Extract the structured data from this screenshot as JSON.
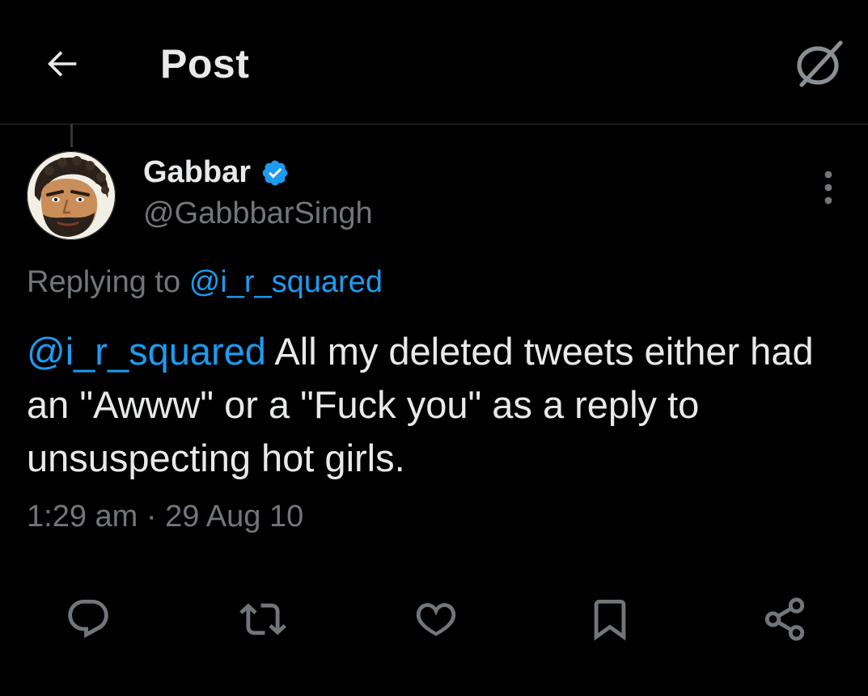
{
  "header": {
    "title": "Post",
    "back_icon": "arrow-left-icon",
    "grok_icon": "grok-icon"
  },
  "post": {
    "author": {
      "display_name": "Gabbar",
      "handle": "@GabbbarSingh",
      "verified": true,
      "verified_color": "#1d9bf0"
    },
    "replying_prefix": "Replying to",
    "replying_to": "@i_r_squared",
    "mention": "@i_r_squared",
    "text": " All my deleted tweets either had an \"Awww\" or a \"Fuck you\" as a reply to unsuspecting hot girls.",
    "timestamp": "1:29 am · 29 Aug 10"
  },
  "actions": [
    {
      "name": "reply",
      "icon": "comment-icon"
    },
    {
      "name": "repost",
      "icon": "repost-icon"
    },
    {
      "name": "like",
      "icon": "heart-icon"
    },
    {
      "name": "bookmark",
      "icon": "bookmark-icon"
    },
    {
      "name": "share",
      "icon": "share-icon"
    }
  ],
  "colors": {
    "background": "#000000",
    "text_primary": "#e7e9ea",
    "text_secondary": "#71767b",
    "link": "#1d9bf0",
    "divider": "#2f3336"
  }
}
